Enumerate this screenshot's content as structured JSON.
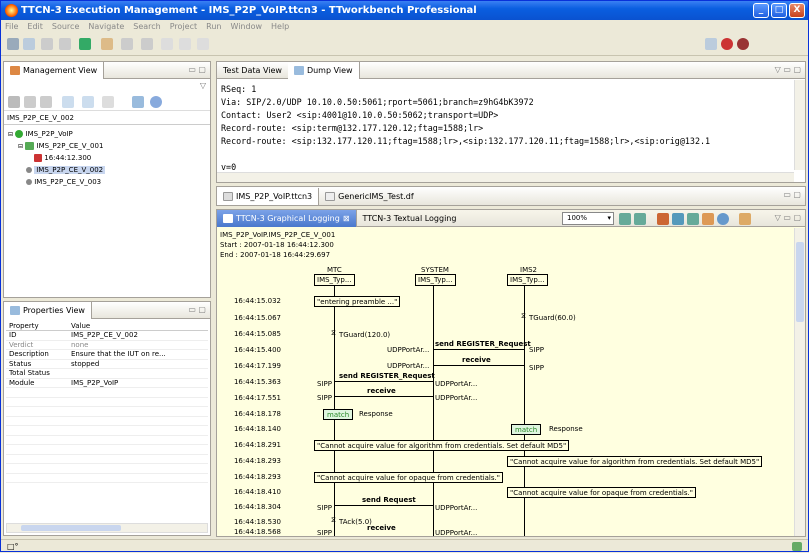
{
  "window": {
    "title": "TTCN-3 Execution Management - IMS_P2P_VoIP.ttcn3 - TTworkbench Professional",
    "buttons": {
      "minimize": "_",
      "maximize": "□",
      "close": "X"
    }
  },
  "menu": [
    "File",
    "Edit",
    "Source",
    "Navigate",
    "Search",
    "Project",
    "Run",
    "Window",
    "Help"
  ],
  "management_view": {
    "tab_label": "Management View",
    "path": "IMS_P2P_CE_V_002",
    "tree": [
      {
        "label": "IMS_P2P_VoIP",
        "icon": "module-icon",
        "level": 0
      },
      {
        "label": "IMS_P2P_CE_V_001",
        "icon": "testcase-icon",
        "level": 1
      },
      {
        "label": "16:44:12.300",
        "icon": "run-icon",
        "level": 2
      },
      {
        "label": "IMS_P2P_CE_V_002",
        "icon": "bullet-icon",
        "level": 1,
        "selected": true
      },
      {
        "label": "IMS_P2P_CE_V_003",
        "icon": "bullet-icon",
        "level": 1
      }
    ]
  },
  "properties_view": {
    "tab_label": "Properties View",
    "columns": [
      "Property",
      "Value"
    ],
    "rows": [
      {
        "property": "ID",
        "value": "IMS_P2P_CE_V_002"
      },
      {
        "property": "Verdict",
        "value": "none"
      },
      {
        "property": "Description",
        "value": "Ensure that the IUT on re..."
      },
      {
        "property": "Status",
        "value": "stopped"
      },
      {
        "property": "Total Status",
        "value": ""
      },
      {
        "property": "Module",
        "value": "IMS_P2P_VoIP"
      }
    ]
  },
  "dump_view": {
    "tabs": [
      "Test Data View",
      "Dump View"
    ],
    "lines": [
      "RSeq: 1",
      "Via: SIP/2.0/UDP 10.10.0.50:5061;rport=5061;branch=z9hG4bK3972",
      "Contact: User2 <sip:4001@10.10.0.50:5062;transport=UDP>",
      "Record-route: <sip:term@132.177.120.12;ftag=1588;lr>",
      "Record-route: <sip:132.177.120.11;ftag=1588;lr>,<sip:132.177.120.11;ftag=1588;lr>,<sip:orig@132.1",
      "",
      "v=0"
    ]
  },
  "editor_tabs": [
    "IMS_P2P_VoIP.ttcn3",
    "GenericIMS_Test.df"
  ],
  "logging": {
    "tabs": [
      "TTCN-3 Graphical Logging",
      "TTCN-3 Textual Logging"
    ],
    "zoom": "100%",
    "header": {
      "name": "IMS_P2P_VoIP.IMS_P2P_CE_V_001",
      "start": "Start : 2007-01-18 16:44:12.300",
      "end": "End   : 2007-01-18 16:44:29.697"
    },
    "components": [
      {
        "name": "MTC",
        "type": "IMS_Typ..."
      },
      {
        "name": "SYSTEM",
        "type": "IMS_Typ..."
      },
      {
        "name": "IMS2",
        "type": "IMS_Typ..."
      }
    ],
    "timestamps": [
      "16:44:15.032",
      "16:44:15.067",
      "16:44:15.085",
      "16:44:15.400",
      "16:44:17.199",
      "16:44:15.363",
      "16:44:17.551",
      "16:44:18.178",
      "16:44:18.140",
      "16:44:18.291",
      "16:44:18.293",
      "16:44:18.293",
      "16:44:18.410",
      "16:44:18.304",
      "16:44:18.530",
      "16:44:18.568"
    ],
    "events": {
      "preamble": "\"entering preamble ...\"",
      "tguard60": "TGuard(60.0)",
      "tguard120": "TGuard(120.0)",
      "send_register": "send REGISTER_Request",
      "udp1": "UDPPortAr...",
      "sipp": "SIPP",
      "receive": "receive",
      "udp2": "UDPPortAr...",
      "sipp2": "SIPP",
      "send_register2": "send REGISTER_Request",
      "sipp3": "SIPP",
      "udp3": "UDPPortAr...",
      "receive2": "receive",
      "sipp4": "SIPP",
      "udp4": "UDPPortAr...",
      "match1": "match",
      "response1": "Response",
      "match2": "match",
      "response2": "Response",
      "alg_msg": "\"Cannot acquire value for algorithm from credentials. Set default MD5\"",
      "alg_msg2": "\"Cannot acquire value for algorithm from credentials. Set default MD5\"",
      "opaque_msg": "\"Cannot acquire value for opaque from credentials.\"",
      "opaque_msg2": "\"Cannot acquire value for opaque from credentials.\"",
      "send_request": "send Request",
      "sipp5": "SIPP",
      "udp5": "UDPPortAr...",
      "tack": "TAck(5.0)",
      "receive3": "receive",
      "sipp6": "SIPP",
      "udp6": "UDPPortAr..."
    }
  },
  "status": {
    "left": "□°"
  }
}
